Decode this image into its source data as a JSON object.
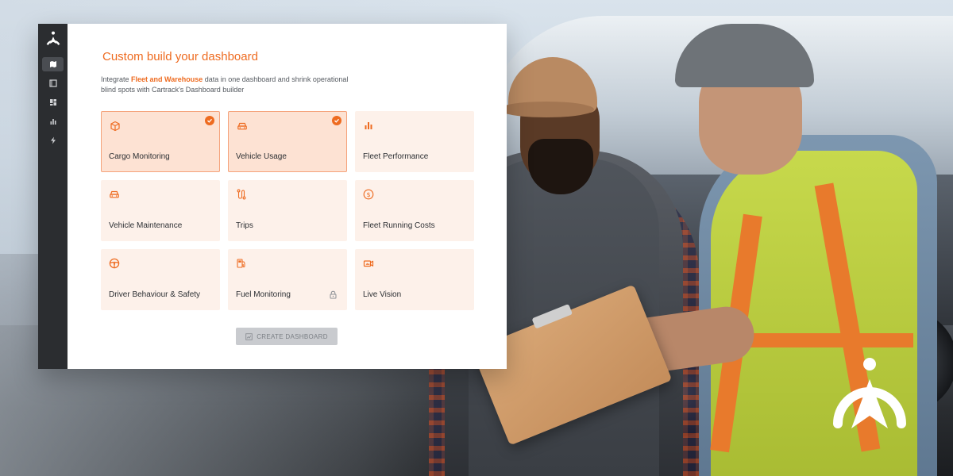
{
  "colors": {
    "accent": "#ee6b20",
    "card_bg": "#fdf1ea",
    "card_selected_bg": "#fde2d3",
    "rail_bg": "#2b2d30",
    "button_disabled_bg": "#c9cbcf"
  },
  "sidebar": {
    "logo_icon": "cartrack-logo-icon",
    "items": [
      {
        "icon": "map-icon",
        "active": true
      },
      {
        "icon": "list-icon",
        "active": false
      },
      {
        "icon": "dashboard-icon",
        "active": false
      },
      {
        "icon": "bar-chart-icon",
        "active": false
      },
      {
        "icon": "lightning-icon",
        "active": false
      }
    ]
  },
  "main": {
    "title": "Custom build your dashboard",
    "subtitle_pre": "Integrate ",
    "subtitle_highlight": "Fleet and Warehouse",
    "subtitle_post": " data in one dashboard and shrink operational blind spots with Cartrack's Dashboard builder",
    "cards": [
      {
        "label": "Cargo Monitoring",
        "icon": "box-icon",
        "selected": true,
        "locked": false
      },
      {
        "label": "Vehicle Usage",
        "icon": "car-icon",
        "selected": true,
        "locked": false
      },
      {
        "label": "Fleet Performance",
        "icon": "bar-chart-icon",
        "selected": false,
        "locked": false
      },
      {
        "label": "Vehicle Maintenance",
        "icon": "car-icon",
        "selected": false,
        "locked": false
      },
      {
        "label": "Trips",
        "icon": "route-icon",
        "selected": false,
        "locked": false
      },
      {
        "label": "Fleet Running Costs",
        "icon": "dollar-icon",
        "selected": false,
        "locked": false
      },
      {
        "label": "Driver Behaviour & Safety",
        "icon": "steering-wheel-icon",
        "selected": false,
        "locked": false
      },
      {
        "label": "Fuel Monitoring",
        "icon": "fuel-pump-icon",
        "selected": false,
        "locked": true
      },
      {
        "label": "Live Vision",
        "icon": "video-camera-icon",
        "selected": false,
        "locked": false
      }
    ],
    "create_button": "CREATE DASHBOARD"
  },
  "brand": {
    "logo_icon": "cartrack-logo-icon"
  }
}
